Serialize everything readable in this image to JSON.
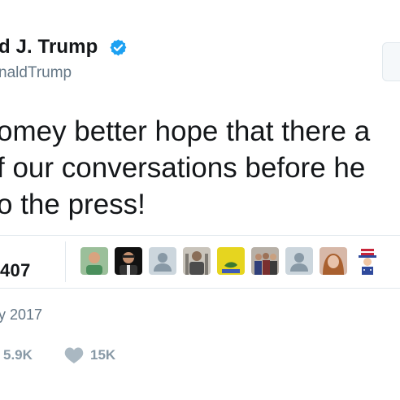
{
  "header": {
    "name": "d J. Trump",
    "handle": "naldTrump"
  },
  "tweet": {
    "lines": [
      "omey better hope that there a",
      "f our conversations before he",
      "o the press!"
    ]
  },
  "stats": {
    "likes_count": "407",
    "avatar_names": [
      "avatar-1",
      "avatar-2",
      "avatar-3",
      "avatar-4",
      "avatar-5",
      "avatar-6",
      "avatar-7",
      "avatar-8",
      "avatar-9"
    ]
  },
  "date": "y 2017",
  "actions": {
    "retweets": "5.9K",
    "likes": "15K"
  },
  "colors": {
    "verified": "#1da1f2",
    "muted": "#657786",
    "action": "#8899a6",
    "divider": "#e1e8ed"
  },
  "icons": {
    "verified": "verified-badge-icon",
    "retweet": "retweet-icon",
    "like": "heart-icon"
  }
}
